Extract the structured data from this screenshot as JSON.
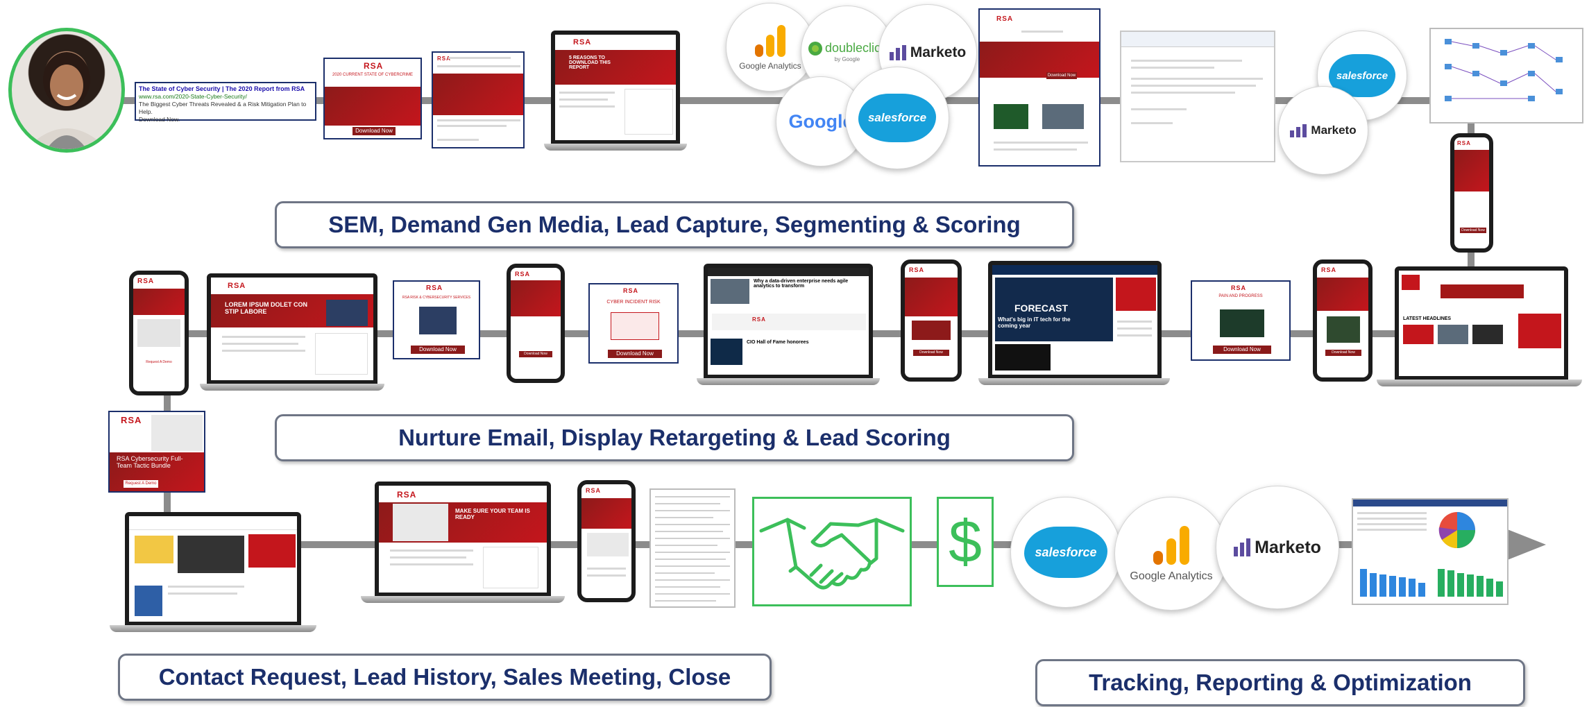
{
  "stages": {
    "stage1": "SEM, Demand Gen Media, Lead Capture, Segmenting & Scoring",
    "stage2": "Nurture Email, Display Retargeting & Lead Scoring",
    "stage3": "Contact Request, Lead History, Sales Meeting, Close",
    "stage4": "Tracking, Reporting & Optimization"
  },
  "ad": {
    "title": "The State of Cyber Security | The 2020 Report from RSA",
    "url": "www.rsa.com/2020-State-Cyber-Security/",
    "line1": "The Biggest Cyber Threats Revealed & a Risk Mitigation Plan to Help.",
    "line2": "Download Now."
  },
  "brand": {
    "rsa": "RSA"
  },
  "logos": {
    "google_analytics": "Google Analytics",
    "doubleclick": "doubleclick",
    "doubleclick_sub": "by Google",
    "marketo": "Marketo",
    "google": "Google",
    "salesforce": "salesforce"
  },
  "content": {
    "report_card_title": "2020 CURRENT STATE OF CYBERCRIME",
    "download_now": "Download Now",
    "reasons_title": "5 REASONS TO DOWNLOAD THIS REPORT",
    "lorem_title": "LOREM IPSUM DOLET CON STIP LABORE",
    "risk_services": "RSA RISK & CYBERSECURITY SERVICES",
    "incident_risk": "CYBER INCIDENT RISK",
    "pain_progress": "PAIN AND PROGRESS",
    "request_demo": "Request A Demo",
    "cto_headline": "Why a data-driven enterprise needs agile analytics to transform",
    "cto_sub": "CIO Hall of Fame honorees",
    "forecast": "FORECAST",
    "forecast_sub": "What's big in IT tech for the coming year",
    "team_ready": "MAKE SURE YOUR TEAM IS READY",
    "bundle_title": "RSA Cybersecurity Full-Team Tactic Bundle",
    "latest_headlines": "LATEST HEADLINES",
    "dollar": "$"
  },
  "colors": {
    "navy": "#1b2f6b",
    "rsa_red": "#c4161c",
    "connector": "#8c8c8c",
    "salesforce": "#17a0db",
    "marketo": "#5c4c9f",
    "green": "#3cbf5a"
  },
  "icons": [
    "handshake-icon",
    "dollar-icon",
    "arrow-right-icon"
  ]
}
